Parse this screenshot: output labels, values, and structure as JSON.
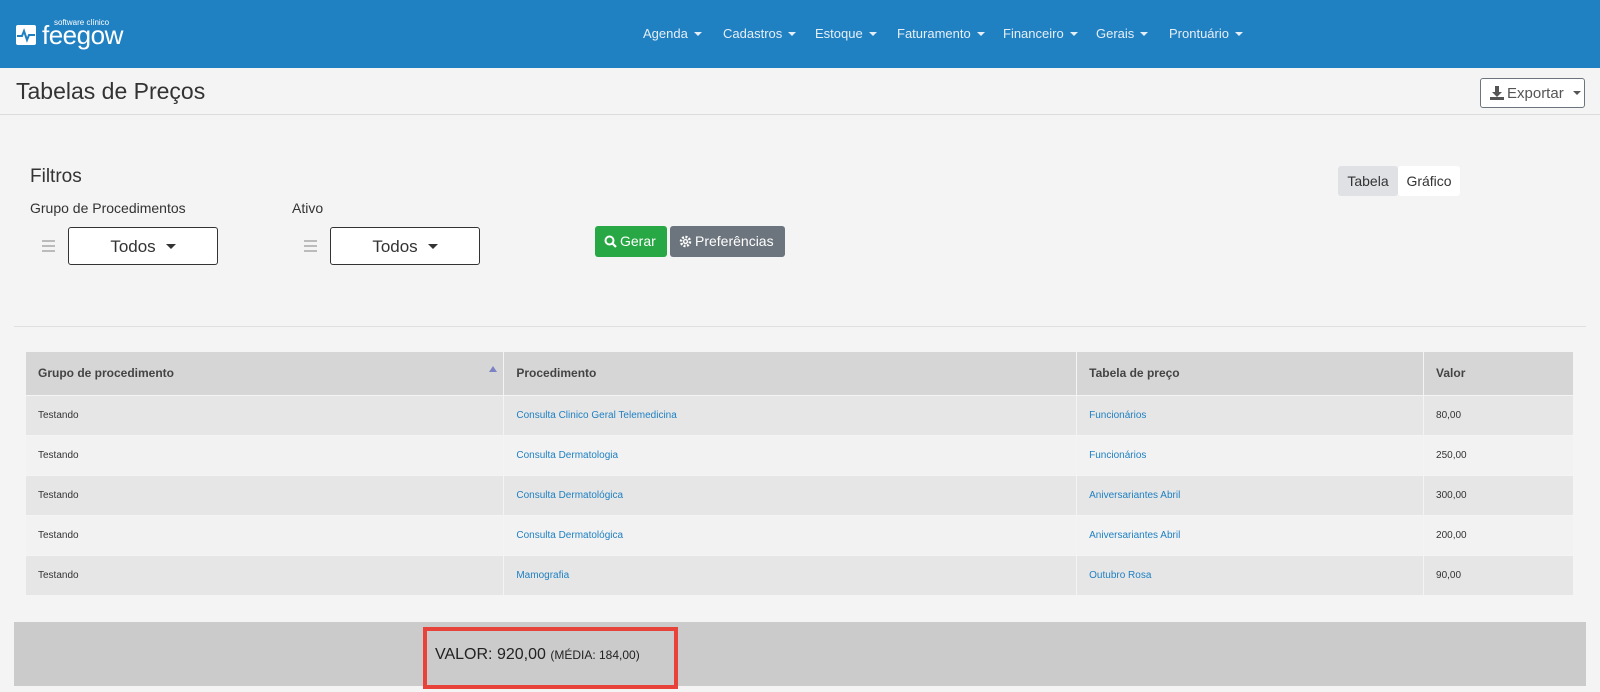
{
  "brand": {
    "logo_small": "software clínico",
    "logo_main": "feegow"
  },
  "nav": {
    "items": [
      {
        "label": "Agenda"
      },
      {
        "label": "Cadastros"
      },
      {
        "label": "Estoque"
      },
      {
        "label": "Faturamento"
      },
      {
        "label": "Financeiro"
      },
      {
        "label": "Gerais"
      },
      {
        "label": "Prontuário"
      }
    ]
  },
  "header": {
    "title": "Tabelas de Preços",
    "export_label": "Exportar"
  },
  "filters": {
    "title": "Filtros",
    "group_label": "Grupo de Procedimentos",
    "group_value": "Todos",
    "ativo_label": "Ativo",
    "ativo_value": "Todos",
    "gerar_label": "Gerar",
    "preferencias_label": "Preferências"
  },
  "view_toggle": {
    "tabela": "Tabela",
    "grafico": "Gráfico",
    "active": "Tabela"
  },
  "table": {
    "columns": [
      "Grupo de procedimento",
      "Procedimento",
      "Tabela de preço",
      "Valor"
    ],
    "rows": [
      {
        "grupo": "Testando",
        "procedimento": "Consulta Clinico Geral Telemedicina",
        "tabela": "Funcionários",
        "valor": "80,00"
      },
      {
        "grupo": "Testando",
        "procedimento": "Consulta Dermatologia",
        "tabela": "Funcionários",
        "valor": "250,00"
      },
      {
        "grupo": "Testando",
        "procedimento": "Consulta Dermatológica",
        "tabela": "Aniversariantes Abril",
        "valor": "300,00"
      },
      {
        "grupo": "Testando",
        "procedimento": "Consulta Dermatológica",
        "tabela": "Aniversariantes Abril",
        "valor": "200,00"
      },
      {
        "grupo": "Testando",
        "procedimento": "Mamografia",
        "tabela": "Outubro Rosa",
        "valor": "90,00"
      }
    ]
  },
  "summary": {
    "valor_label": "VALOR:",
    "valor": "920,00",
    "media_text": "(MÉDIA: 184,00)"
  },
  "colors": {
    "navbar": "#1f80c2",
    "link": "#1f80c2",
    "gerar": "#28a745",
    "preferencias": "#6c757d",
    "highlight": "#e8433a"
  }
}
